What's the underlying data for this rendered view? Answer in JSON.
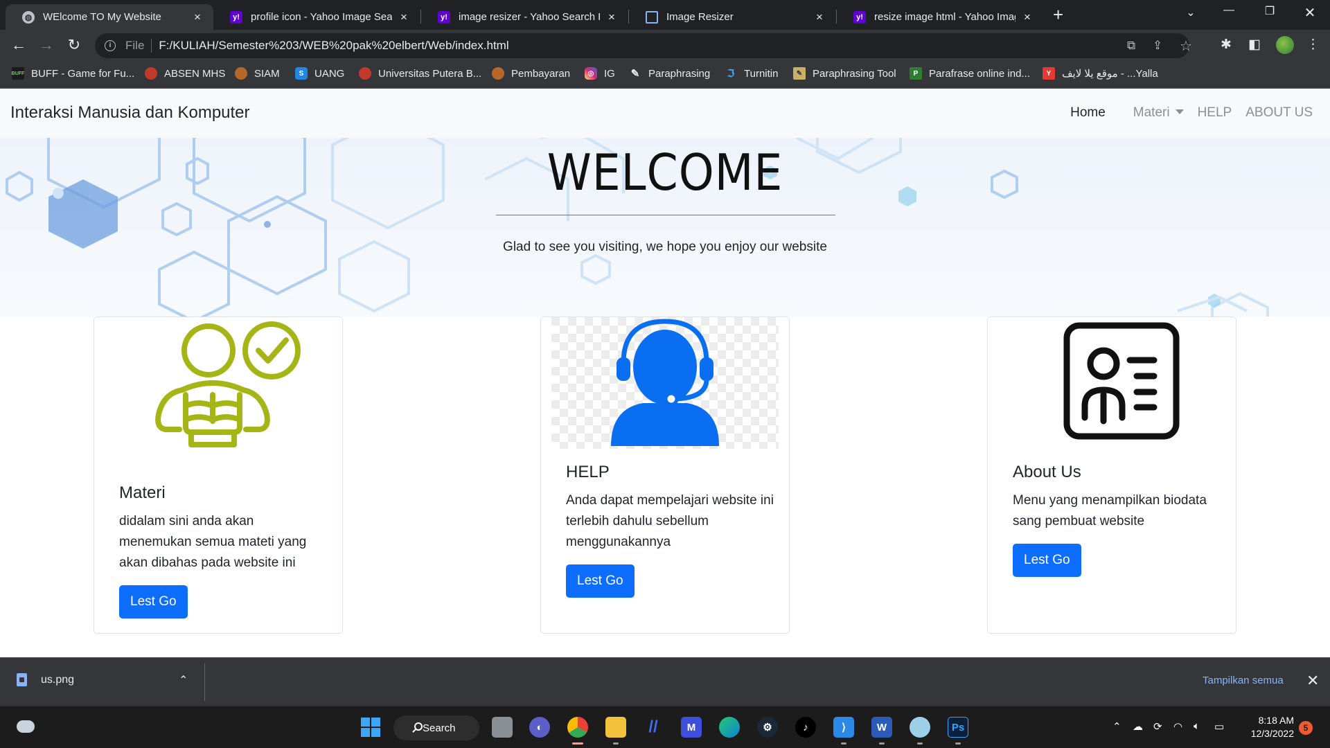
{
  "browser": {
    "tabs": [
      {
        "title": "WElcome TO My Website",
        "favicon": "globe-icon",
        "active": true
      },
      {
        "title": "profile icon - Yahoo Image Search",
        "favicon": "yahoo-icon",
        "active": false
      },
      {
        "title": "image resizer - Yahoo Search Res",
        "favicon": "yahoo-icon",
        "active": false
      },
      {
        "title": "Image Resizer",
        "favicon": "resize-icon",
        "active": false
      },
      {
        "title": "resize image html - Yahoo Image",
        "favicon": "yahoo-icon",
        "active": false
      }
    ],
    "address": {
      "scheme": "File",
      "url": "F:/KULIAH/Semester%203/WEB%20pak%20elbert/Web/index.html"
    },
    "bookmarks": [
      {
        "label": "BUFF - Game for Fu...",
        "color": "#1b1b1b"
      },
      {
        "label": "ABSEN MHS",
        "color": "#c0392b"
      },
      {
        "label": "SIAM",
        "color": "#b8672b"
      },
      {
        "label": "UANG",
        "color": "#1e88e5"
      },
      {
        "label": "Universitas Putera B...",
        "color": "#c0392b"
      },
      {
        "label": "Pembayaran",
        "color": "#b8672b"
      },
      {
        "label": "IG",
        "color": "#d62976"
      },
      {
        "label": "Paraphrasing",
        "color": "#35363a"
      },
      {
        "label": "Turnitin",
        "color": "#1565c0"
      },
      {
        "label": "Paraphrasing Tool",
        "color": "#c8b068"
      },
      {
        "label": "Parafrase online ind...",
        "color": "#2e7d32"
      },
      {
        "label": "موقع يلا لايف - ...Yalla",
        "color": "#e53935"
      }
    ]
  },
  "site": {
    "brand": "Interaksi Manusia dan Komputer",
    "nav": {
      "home": "Home",
      "materi": "Materi",
      "help": "HELP",
      "about": "ABOUT US"
    },
    "hero": {
      "title": "WELCOME",
      "subtitle": "Glad to see you visiting, we hope you enjoy our website"
    },
    "cards": [
      {
        "title": "Materi",
        "text": "didalam sini anda akan menemukan semua mateti yang akan dibahas pada website ini",
        "button": "Lest Go",
        "icon": "reader-check-icon"
      },
      {
        "title": "HELP",
        "text": "Anda dapat mempelajari website ini terlebih dahulu sebellum menggunakannya",
        "button": "Lest Go",
        "icon": "headset-support-icon"
      },
      {
        "title": "About Us",
        "text": "Menu yang menampilkan biodata sang pembuat website",
        "button": "Lest Go",
        "icon": "id-card-icon"
      }
    ]
  },
  "downloads": {
    "file": "us.png",
    "show_all": "Tampilkan semua"
  },
  "taskbar": {
    "search": "Search",
    "time": "8:18 AM",
    "date": "12/3/2022",
    "notifications": "5"
  },
  "colors": {
    "accent": "#0d6efd",
    "materi_icon": "#a6b516",
    "help_icon": "#0a6ef0"
  }
}
